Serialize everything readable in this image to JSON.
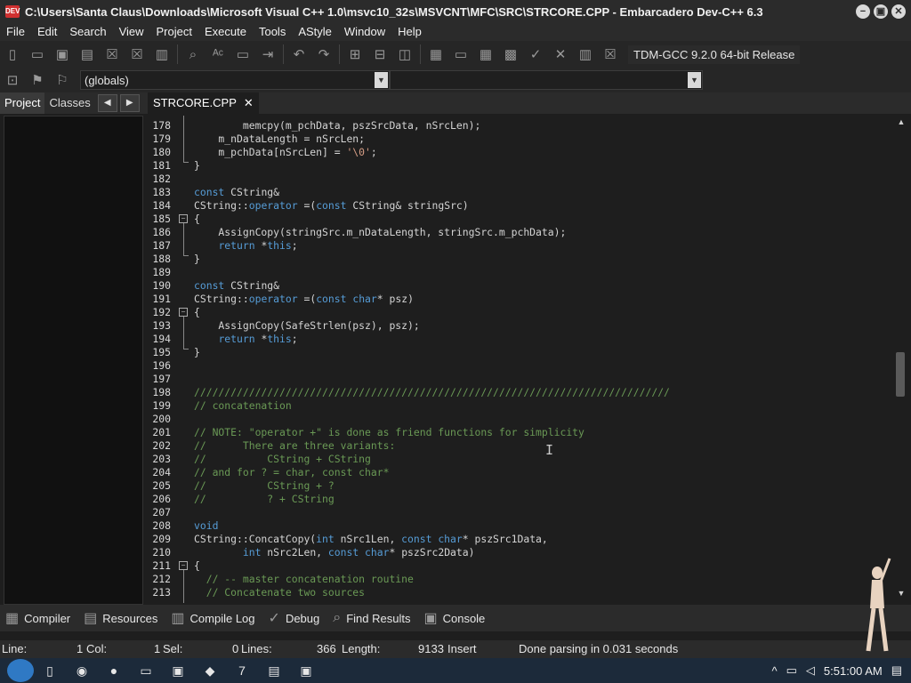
{
  "window": {
    "title": "C:\\Users\\Santa Claus\\Downloads\\Microsoft Visual C++ 1.0\\msvc10_32s\\MSVCNT\\MFC\\SRC\\STRCORE.CPP - Embarcadero Dev-C++ 6.3",
    "app_icon": "DEV",
    "minimize": "−",
    "maximize": "▣",
    "close": "✕"
  },
  "menu": [
    "File",
    "Edit",
    "Search",
    "View",
    "Project",
    "Execute",
    "Tools",
    "AStyle",
    "Window",
    "Help"
  ],
  "toolbar": {
    "compiler": "TDM-GCC 9.2.0 64-bit Release",
    "scope": "(globals)",
    "symbol": ""
  },
  "left_panel": {
    "tabs": [
      "Project",
      "Classes"
    ],
    "prev": "◀",
    "next": "▶"
  },
  "editor": {
    "tab_label": "STRCORE.CPP",
    "tab_close": "✕"
  },
  "bottom_tabs": [
    {
      "label": "Compiler",
      "icon": "▦"
    },
    {
      "label": "Resources",
      "icon": "▤"
    },
    {
      "label": "Compile Log",
      "icon": "▥"
    },
    {
      "label": "Debug",
      "icon": "✓"
    },
    {
      "label": "Find Results",
      "icon": "⌕"
    },
    {
      "label": "Console",
      "icon": "▣"
    }
  ],
  "status": {
    "line_label": "Line:",
    "line": "1",
    "col_label": "Col:",
    "col": "1",
    "sel_label": "Sel:",
    "sel": "0",
    "lines_label": "Lines:",
    "lines": "366",
    "length_label": "Length:",
    "length": "9133",
    "mode": "Insert",
    "message": "Done parsing in 0.031 seconds"
  },
  "taskbar": {
    "time": "5:51:00 AM"
  }
}
